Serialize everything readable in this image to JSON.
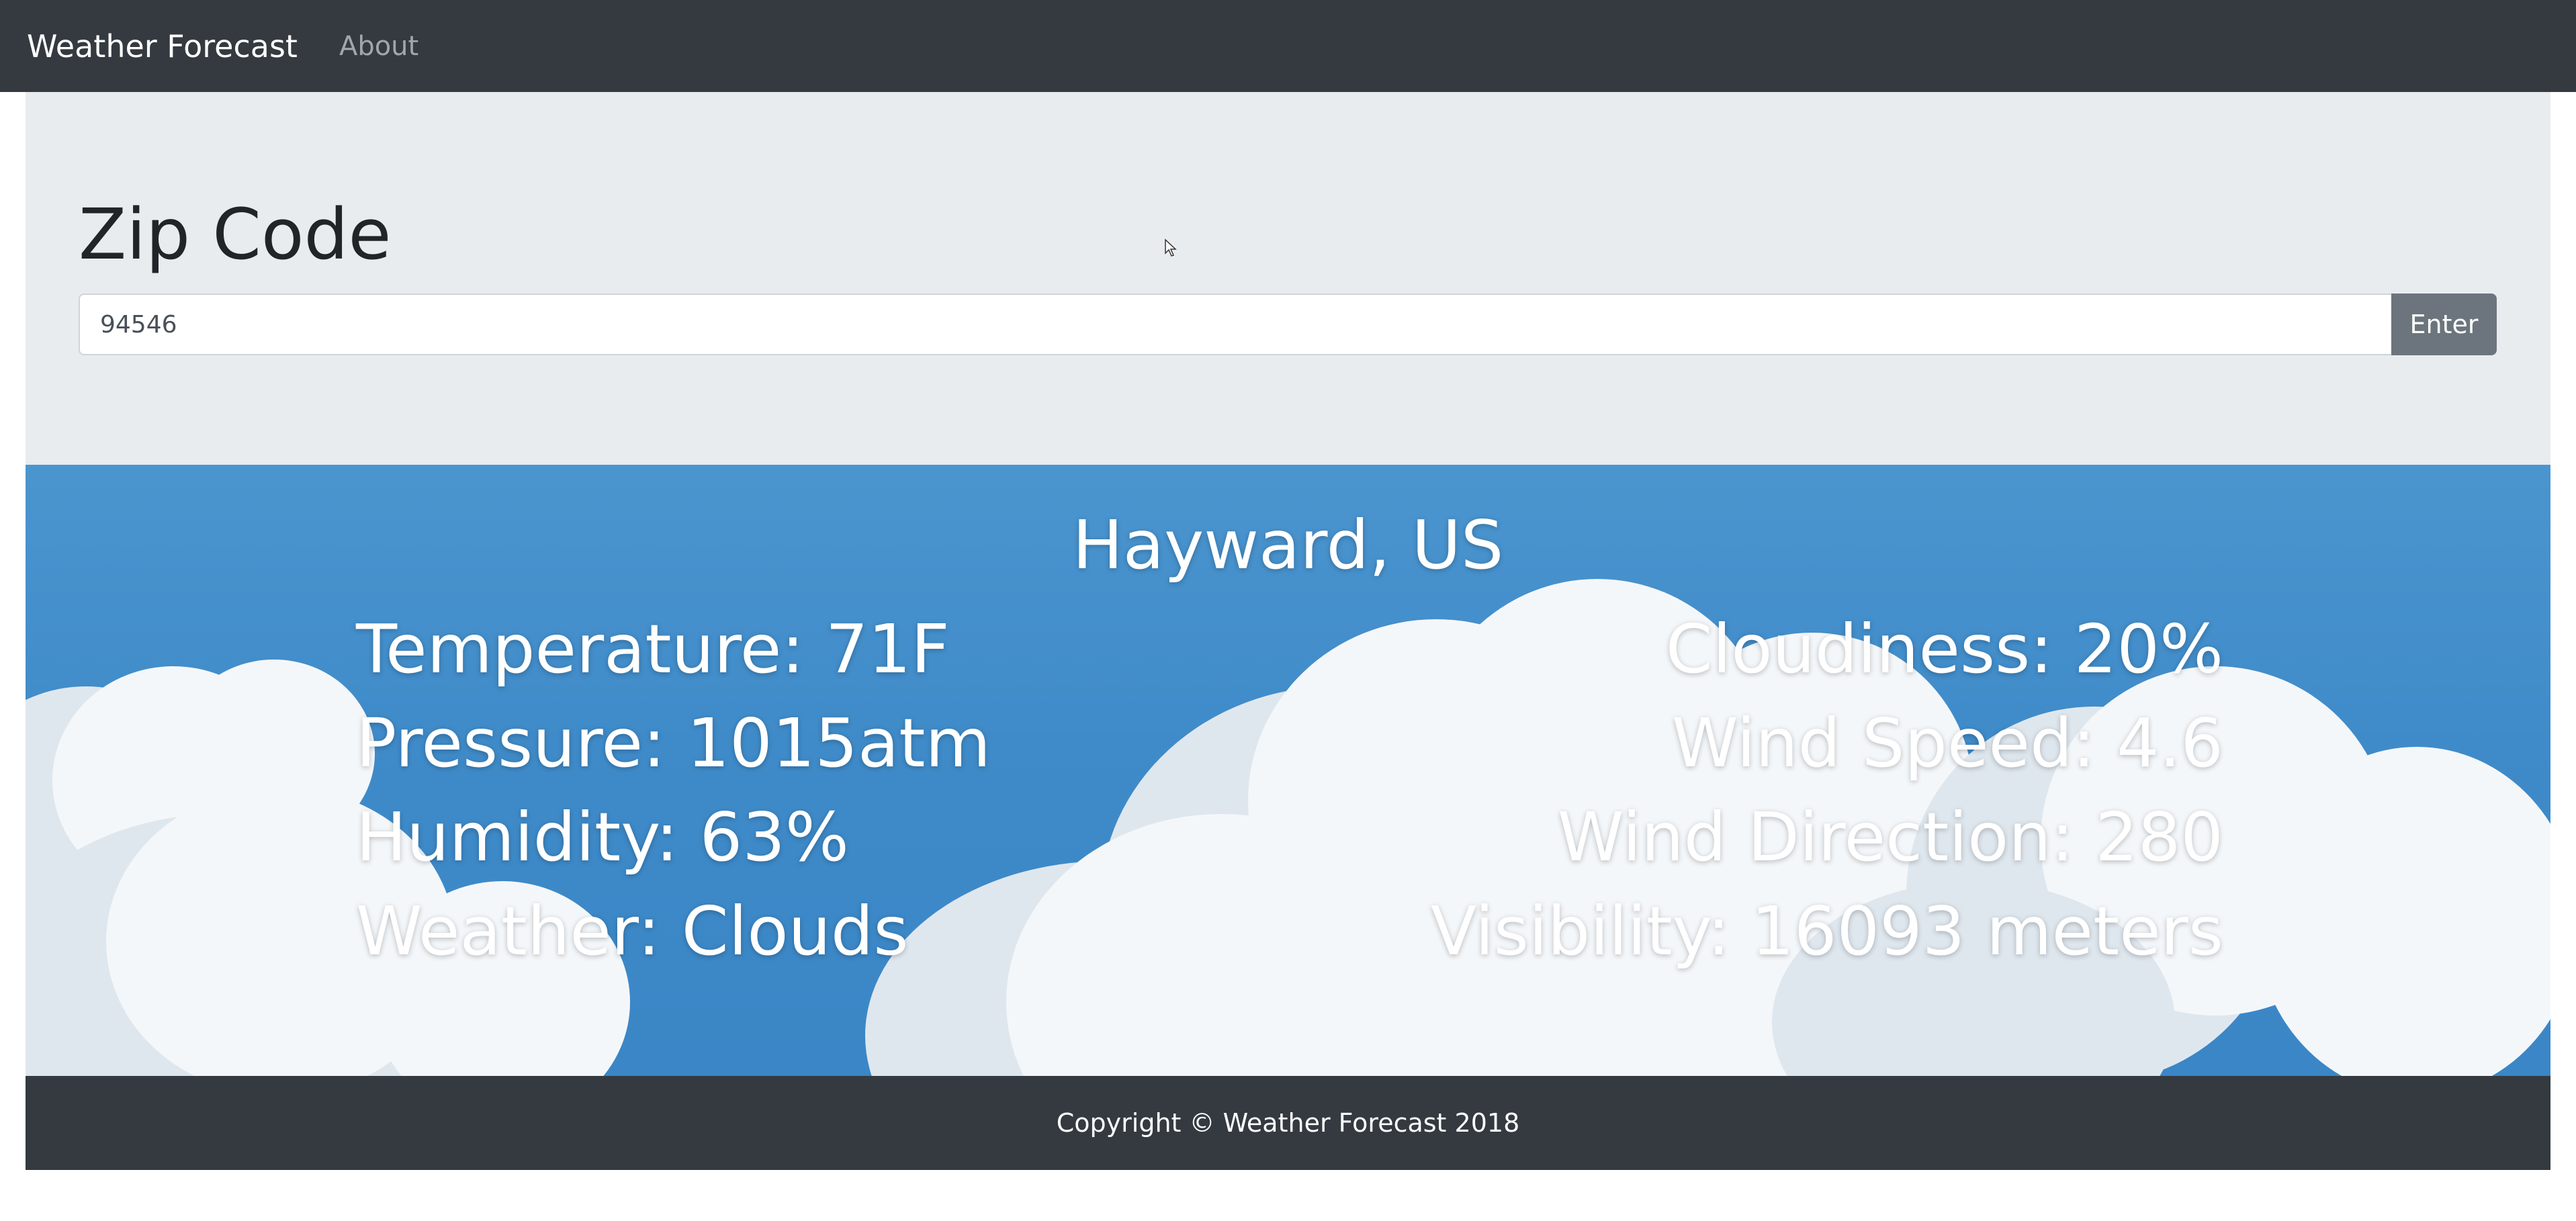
{
  "navbar": {
    "brand": "Weather Forecast",
    "links": [
      "About"
    ]
  },
  "search": {
    "heading": "Zip Code",
    "value": "94546",
    "button_label": "Enter"
  },
  "weather": {
    "city": "Hayward, US",
    "left": [
      "Temperature: 71F",
      "Pressure: 1015atm",
      "Humidity: 63%",
      "Weather: Clouds"
    ],
    "right": [
      "Cloudiness: 20%",
      "Wind Speed: 4.6",
      "Wind Direction: 280",
      "Visibility: 16093 meters"
    ]
  },
  "footer": {
    "text": "Copyright © Weather Forecast 2018"
  },
  "colors": {
    "navbar": "#343a40",
    "jumbotron": "#e9ecef",
    "sky": "#3f8bc9",
    "button": "#6c757d"
  },
  "icons": [
    "mouse-cursor-icon",
    "clouds-background-image"
  ]
}
